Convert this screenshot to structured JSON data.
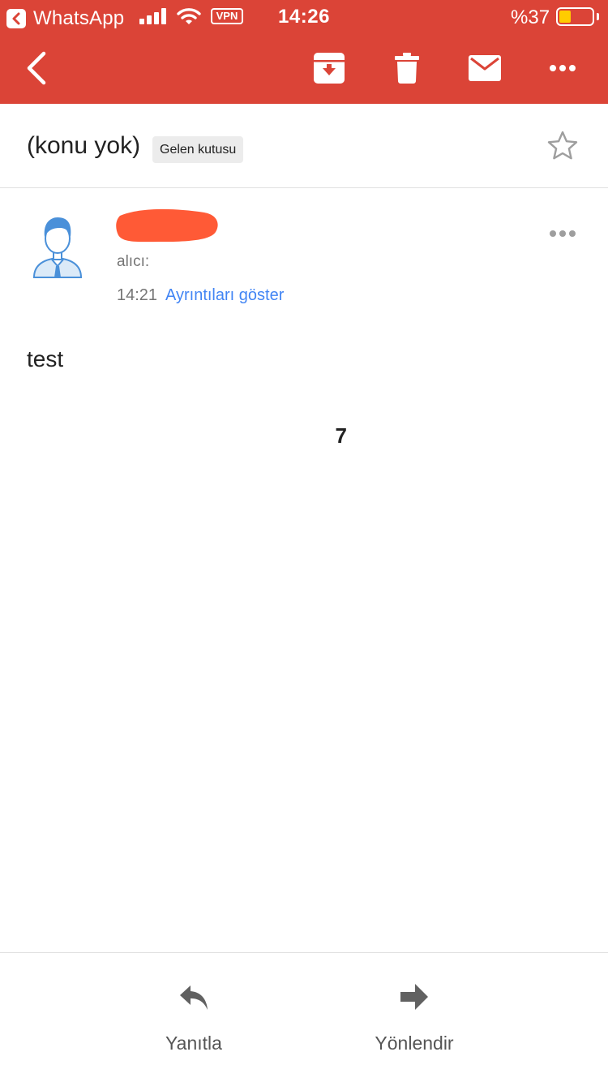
{
  "status_bar": {
    "back_app_label": "WhatsApp",
    "vpn_label": "VPN",
    "time": "14:26",
    "battery_percent_label": "%37",
    "battery_level": 0.37,
    "battery_color": "#ffcc00"
  },
  "toolbar": {
    "bar_color": "#db4437",
    "icons": [
      "back-icon",
      "archive-icon",
      "delete-icon",
      "mail-icon",
      "more-icon"
    ]
  },
  "message": {
    "subject": "(konu yok)",
    "label": "Gelen kutusu",
    "sender_visible_suffix": "7",
    "to_label": "alıcı:",
    "time": "14:21",
    "details_link": "Ayrıntıları göster",
    "body": "test"
  },
  "bottom_actions": {
    "reply_label": "Yanıtla",
    "forward_label": "Yönlendir"
  },
  "colors": {
    "accent": "#db4437",
    "link": "#4285f4",
    "redaction": "#ff5a36"
  }
}
